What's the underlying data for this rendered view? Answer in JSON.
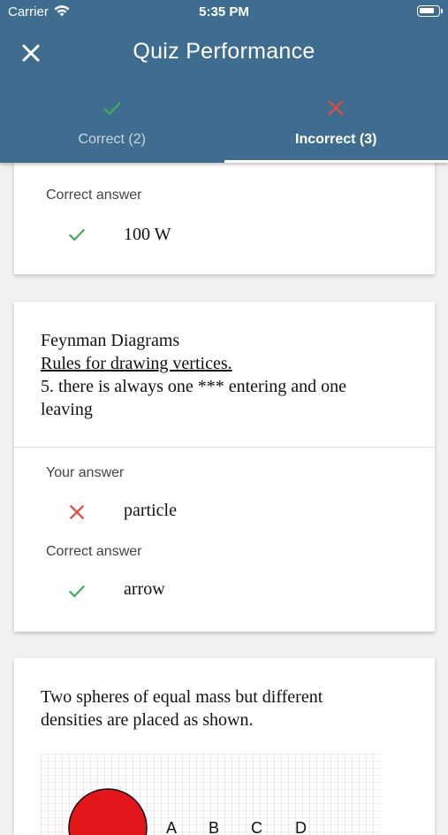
{
  "status_bar": {
    "carrier": "Carrier",
    "time": "5:35 PM"
  },
  "header": {
    "title": "Quiz Performance"
  },
  "tabs": [
    {
      "label": "Correct (2)",
      "icon": "check-icon",
      "color": "#3fae5a"
    },
    {
      "label": "Incorrect (3)",
      "icon": "x-icon",
      "color": "#e8493a"
    }
  ],
  "cards": [
    {
      "correct_answer_label": "Correct answer",
      "correct_answer": "100 W"
    },
    {
      "question_line1": "Feynman Diagrams",
      "question_line2": "Rules for drawing vertices.",
      "question_line3": "5. there is always one *** entering and one",
      "question_line4": "leaving",
      "your_answer_label": "Your answer",
      "your_answer": "particle",
      "correct_answer_label": "Correct answer",
      "correct_answer": "arrow"
    },
    {
      "question_line1": "Two spheres of equal mass but different",
      "question_line2": "densities are placed as shown.",
      "figure_labels": [
        "A",
        "B",
        "C",
        "D"
      ]
    }
  ],
  "colors": {
    "header": "#3f6d8f",
    "correct": "#3fae5a",
    "incorrect": "#e8493a"
  }
}
